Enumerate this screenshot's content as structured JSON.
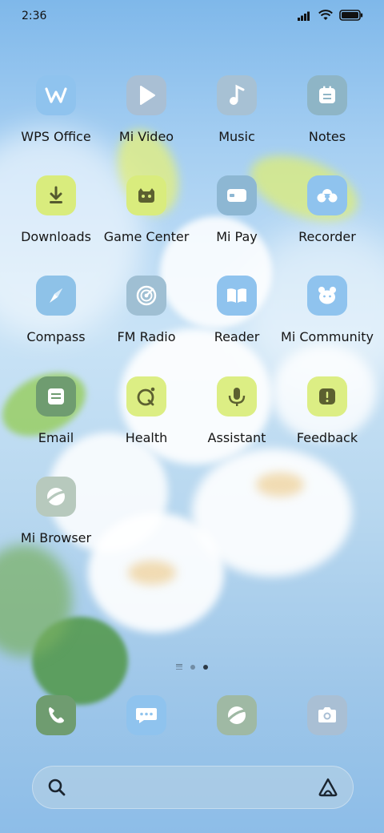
{
  "status_bar": {
    "time": "2:36"
  },
  "apps": [
    {
      "label": "WPS Office",
      "icon": "wps-office-icon",
      "color": "#8fc3ee"
    },
    {
      "label": "Mi Video",
      "icon": "mi-video-icon",
      "color": "#a9bfd4"
    },
    {
      "label": "Music",
      "icon": "music-note-icon",
      "color": "#a7c1d4"
    },
    {
      "label": "Notes",
      "icon": "notes-icon",
      "color": "#8eb5c6"
    },
    {
      "label": "Downloads",
      "icon": "downloads-icon",
      "color": "#d9ec7d"
    },
    {
      "label": "Game Center",
      "icon": "game-center-icon",
      "color": "#d9ec7d"
    },
    {
      "label": "Mi Pay",
      "icon": "mi-pay-icon",
      "color": "#8db7d3"
    },
    {
      "label": "Recorder",
      "icon": "recorder-icon",
      "color": "#8fc3ee"
    },
    {
      "label": "Compass",
      "icon": "compass-icon",
      "color": "#8ec2e8"
    },
    {
      "label": "FM Radio",
      "icon": "fm-radio-icon",
      "color": "#9fbfd3"
    },
    {
      "label": "Reader",
      "icon": "reader-book-icon",
      "color": "#8fc3ee"
    },
    {
      "label": "Mi Community",
      "icon": "mi-community-icon",
      "color": "#8fc3ee"
    },
    {
      "label": "Email",
      "icon": "email-icon",
      "color": "#6f9c70"
    },
    {
      "label": "Health",
      "icon": "health-icon",
      "color": "#dcee84"
    },
    {
      "label": "Assistant",
      "icon": "assistant-mic-icon",
      "color": "#dcee84"
    },
    {
      "label": "Feedback",
      "icon": "feedback-icon",
      "color": "#dcee84"
    },
    {
      "label": "Mi Browser",
      "icon": "mi-browser-icon",
      "color": "#b7c9bd"
    }
  ],
  "dock": [
    {
      "icon": "phone-icon",
      "color": "#6f9c70"
    },
    {
      "icon": "messages-icon",
      "color": "#8fc3ee"
    },
    {
      "icon": "browser-icon",
      "color": "#9fb9a4"
    },
    {
      "icon": "camera-icon",
      "color": "#a9bfd4"
    }
  ]
}
